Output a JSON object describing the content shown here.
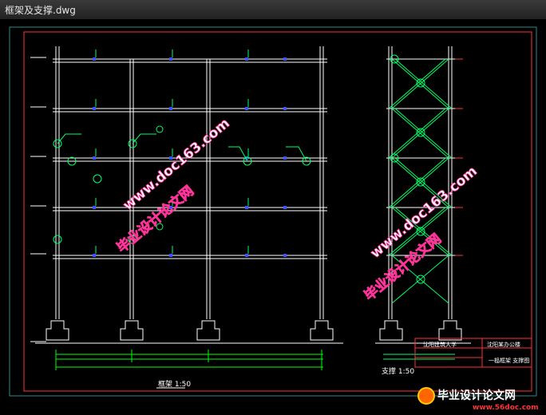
{
  "window": {
    "title": "框架及支撑.dwg"
  },
  "drawing": {
    "frame_caption": "框架 1:50",
    "brace_caption": "支撑 1:50",
    "title_block": {
      "school": "沈阳建筑大学",
      "project": "沈阳某办公楼",
      "sheet": "一榀框架 支撑图"
    }
  },
  "watermarks": {
    "site_a": "www.doc163.com",
    "site_b": "毕业设计论文网",
    "logo_text": "毕业设计论文网",
    "logo_url": "www.56doc.com"
  },
  "colors": {
    "frame_line": "#ffffff",
    "brace": "#00ff66",
    "border": "#ff3333",
    "dim": "#00ff00",
    "wm": "#ff3399",
    "wm_fill": "#ffffff"
  }
}
